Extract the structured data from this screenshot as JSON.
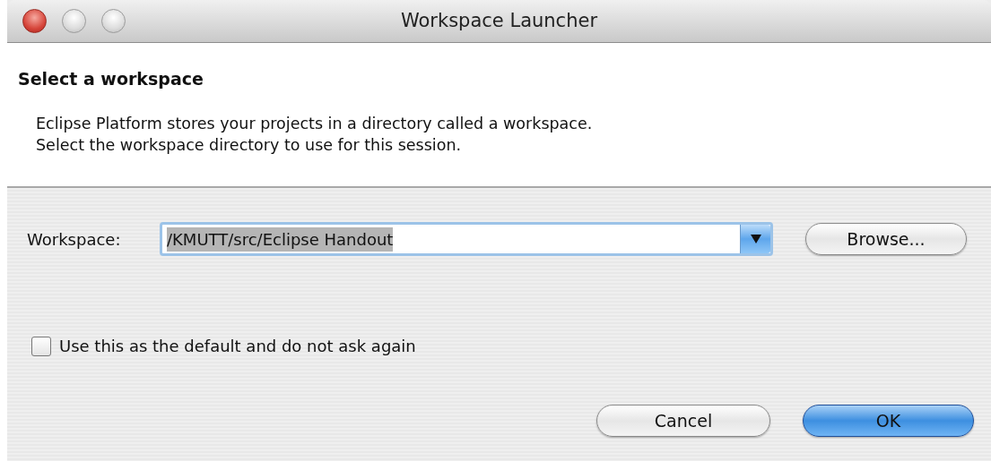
{
  "window": {
    "title": "Workspace Launcher"
  },
  "header": {
    "title": "Select a workspace",
    "description": [
      "Eclipse Platform stores your projects in a directory called a workspace.",
      "Select the workspace directory to use for this session."
    ]
  },
  "workspace": {
    "label": "Workspace:",
    "value": "/KMUTT/src/Eclipse Handout",
    "selected": true
  },
  "browse_button": "Browse...",
  "checkbox": {
    "label": "Use this as the default and do not ask again",
    "checked": false
  },
  "buttons": [
    {
      "label": "Cancel",
      "default": false
    },
    {
      "label": "OK",
      "default": true
    }
  ]
}
